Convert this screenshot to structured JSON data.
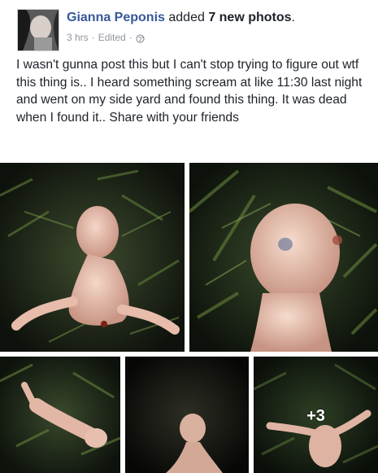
{
  "post": {
    "author": "Gianna Peponis",
    "action_text": " added ",
    "photo_count": "7 new photos",
    "period": ".",
    "time": "3 hrs",
    "edited": "Edited",
    "body": "I wasn't gunna post this but I can't stop trying to figure out wtf this thing is.. I heard something scream at like 11:30 last night and went on my side yard and found this thing. It was dead when I found it.. Share with your friends"
  },
  "gallery": {
    "more_count": "+3"
  },
  "colors": {
    "author_link": "#365899",
    "meta_gray": "#90949c",
    "text": "#1d2129"
  },
  "icons": {
    "privacy": "globe-icon"
  }
}
